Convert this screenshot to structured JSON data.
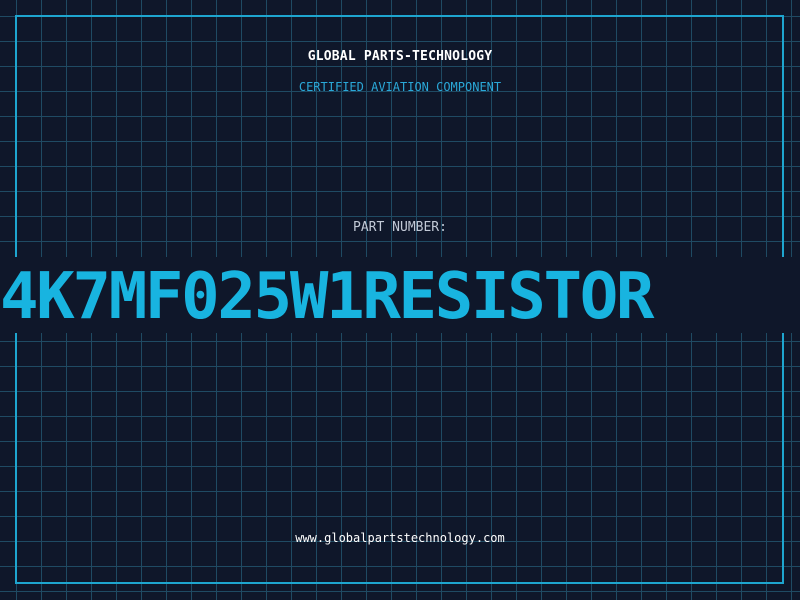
{
  "brand": {
    "name": "GLOBAL PARTS-TECHNOLOGY",
    "certification": "CERTIFIED AVIATION COMPONENT"
  },
  "part": {
    "label": "PART NUMBER:",
    "number": "4K7MF025W1RESISTOR"
  },
  "footer": {
    "website": "www.globalpartstechnology.com"
  },
  "colors": {
    "background": "#0f172a",
    "grid": "#1f4a63",
    "accent": "#18b4e0",
    "frame": "#1ea5cf"
  }
}
